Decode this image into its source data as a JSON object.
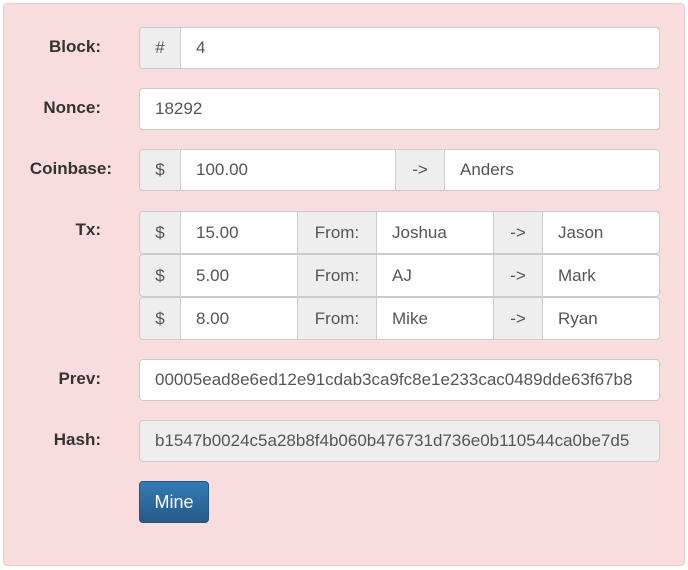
{
  "labels": {
    "block": "Block:",
    "nonce": "Nonce:",
    "coinbase": "Coinbase:",
    "tx": "Tx:",
    "prev": "Prev:",
    "hash": "Hash:"
  },
  "block": {
    "prefix": "#",
    "value": "4"
  },
  "nonce": {
    "value": "18292"
  },
  "coinbase": {
    "currency": "$",
    "amount": "100.00",
    "arrow": "->",
    "to": "Anders"
  },
  "tx": [
    {
      "currency": "$",
      "amount": "15.00",
      "from_label": "From:",
      "from": "Joshua",
      "arrow": "->",
      "to": "Jason"
    },
    {
      "currency": "$",
      "amount": "5.00",
      "from_label": "From:",
      "from": "AJ",
      "arrow": "->",
      "to": "Mark"
    },
    {
      "currency": "$",
      "amount": "8.00",
      "from_label": "From:",
      "from": "Mike",
      "arrow": "->",
      "to": "Ryan"
    }
  ],
  "prev": {
    "value": "00005ead8e6ed12e91cdab3ca9fc8e1e233cac0489dde63f67b8"
  },
  "hash": {
    "value": "b1547b0024c5a28b8f4b060b476731d736e0b110544ca0be7d5"
  },
  "mine_button": {
    "label": "Mine"
  },
  "colors": {
    "panel_bg": "#f9dcdd",
    "button_bg": "#337ab7"
  }
}
